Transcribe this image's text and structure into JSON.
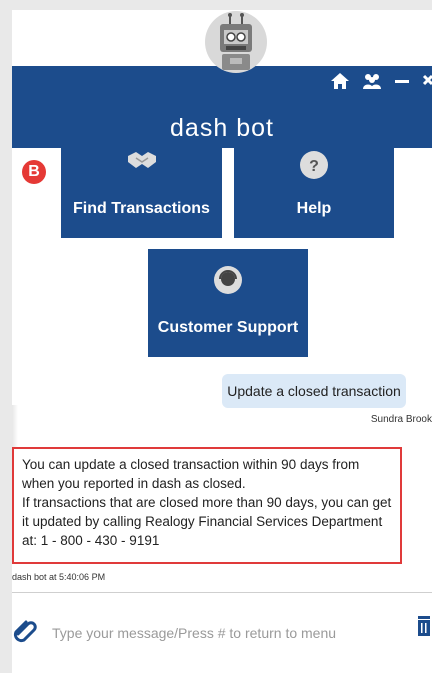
{
  "header": {
    "title": "dash bot",
    "icons": [
      "home-icon",
      "users-icon",
      "minimize-icon",
      "close-icon"
    ]
  },
  "menu": {
    "badge": "B",
    "tiles": [
      {
        "label": "Find Transactions",
        "icon": "handshake-icon"
      },
      {
        "label": "Help",
        "icon": "question-icon"
      },
      {
        "label": "Customer Support",
        "icon": "headset-icon"
      }
    ]
  },
  "conversation": {
    "user_message": "Update a closed transaction",
    "user_name": "Sundra Brook",
    "bot_lines": [
      "You can update a closed transaction within 90 days from when you reported in dash as closed.",
      "If transactions that are closed more than 90 days, you can get it updated by calling Realogy Financial Services Department at: 1 - 800 - 430 - 9191"
    ],
    "bot_timestamp": "dash bot at 5:40:06 PM"
  },
  "composer": {
    "placeholder": "Type your message/Press # to return to menu"
  },
  "colors": {
    "brand": "#1c4c8c",
    "highlight": "#e03a3a",
    "user_bubble": "#dbe9f7"
  }
}
